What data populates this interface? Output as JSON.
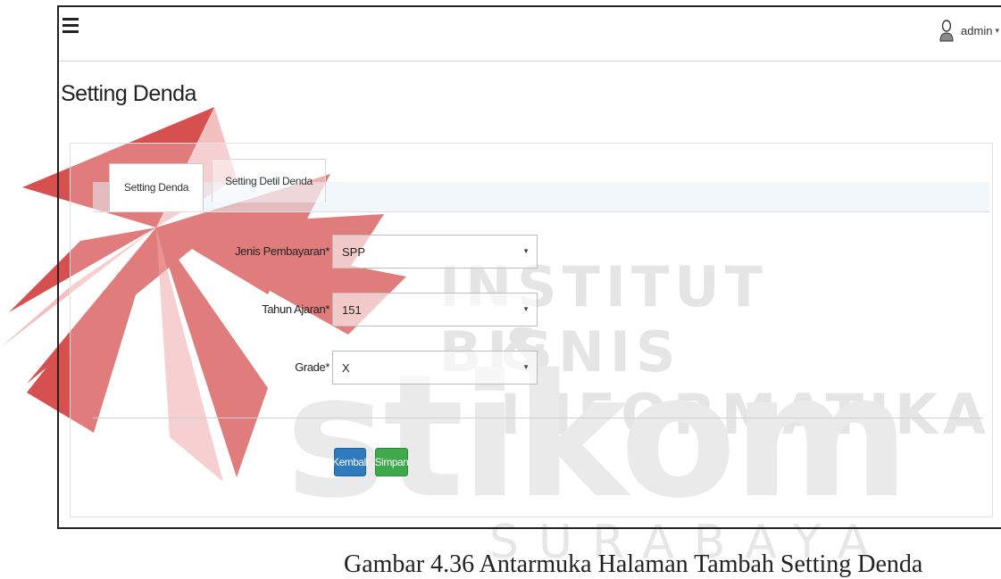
{
  "watermark": {
    "line1": "INSTITUT BISNIS",
    "line2": "& INFORMATIKA",
    "brand": "stikom",
    "city": "SURABAYA",
    "caption": "Gambar 4.36 Antarmuka Halaman Tambah Setting Denda"
  },
  "header": {
    "menu_icon": "hamburger-icon",
    "user_icon": "user-icon",
    "username": "admin",
    "caret": "▾"
  },
  "page": {
    "title": "Setting Denda"
  },
  "tabs": [
    {
      "label": "Setting Denda",
      "active": true
    },
    {
      "label": "Setting Detil Denda",
      "active": false
    }
  ],
  "form": {
    "fields": [
      {
        "label": "Jenis Pembayaran*",
        "value": "SPP"
      },
      {
        "label": "Tahun Ajaran*",
        "value": "151"
      },
      {
        "label": "Grade*",
        "value": "X"
      }
    ],
    "select_caret": "▼"
  },
  "buttons": {
    "back_label": "Kembali",
    "save_label": "Simpan"
  },
  "colors": {
    "primary": "#2f7bbf",
    "success": "#3fa84a",
    "border": "#bdbdbd"
  }
}
